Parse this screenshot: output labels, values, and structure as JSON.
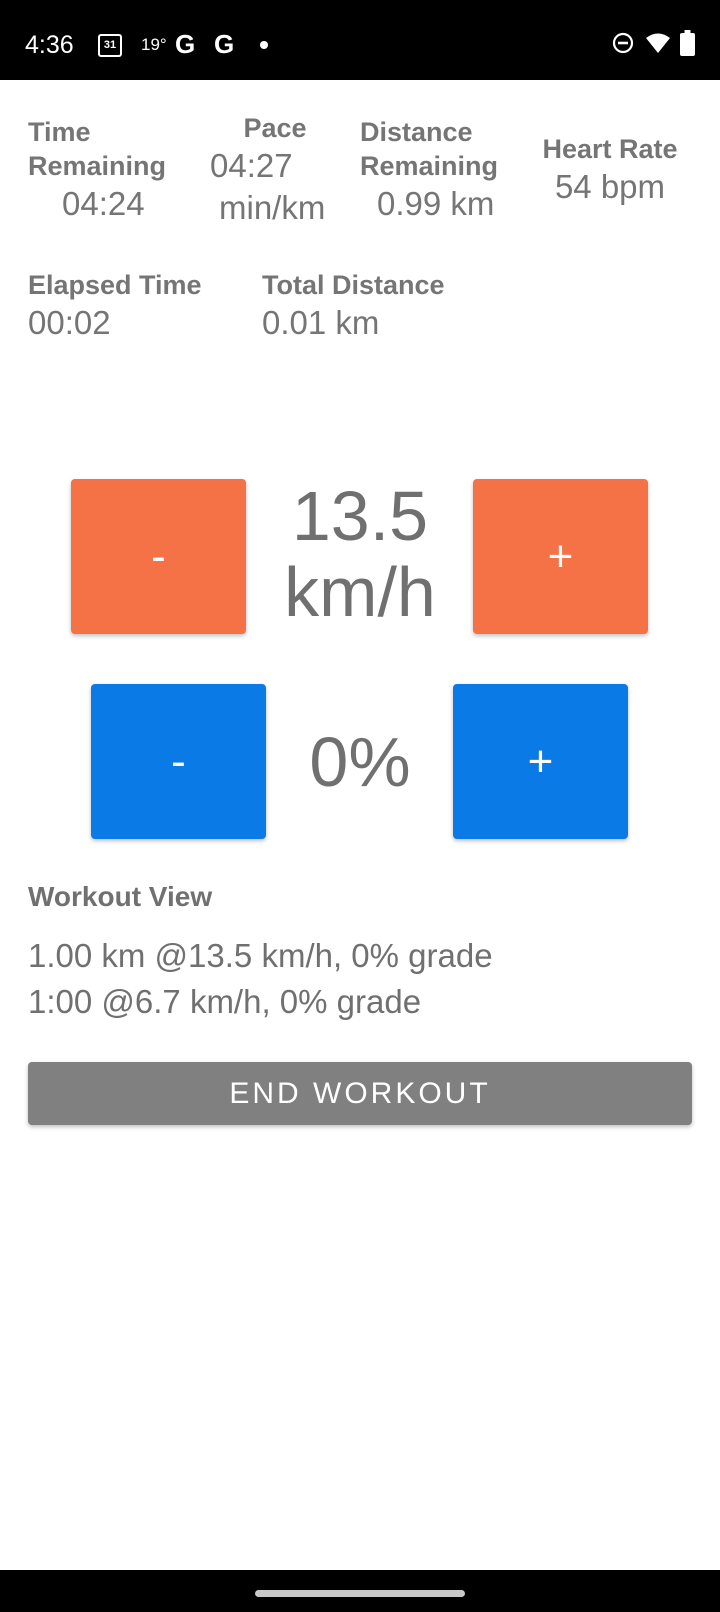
{
  "status_bar": {
    "time": "4:36",
    "calendar_day": "31",
    "temperature": "19°",
    "google_letter_1": "G",
    "google_letter_2": "G",
    "icons": [
      "calendar-icon",
      "google-icon",
      "google-icon",
      "notification-dot-icon",
      "do-not-disturb-icon",
      "wifi-icon",
      "battery-icon"
    ]
  },
  "stats": {
    "time_remaining": {
      "label_line1": "Time",
      "label_line2": "Remaining",
      "value": "04:24"
    },
    "pace": {
      "label": "Pace",
      "value_line1": "04:27",
      "value_line2": "min/km"
    },
    "distance_remaining": {
      "label_line1": "Distance",
      "label_line2": "Remaining",
      "value": "0.99 km"
    },
    "heart_rate": {
      "label": "Heart Rate",
      "value": "54 bpm"
    },
    "elapsed_time": {
      "label": "Elapsed Time",
      "value": "00:02"
    },
    "total_distance": {
      "label": "Total Distance",
      "value": "0.01 km"
    }
  },
  "speed": {
    "value": "13.5",
    "unit": "km/h",
    "decrease_label": "-",
    "increase_label": "+",
    "button_color": "#f47246"
  },
  "incline": {
    "value": "0%",
    "decrease_label": "-",
    "increase_label": "+",
    "button_color": "#0a7ae6"
  },
  "workout_view": {
    "title": "Workout View",
    "steps": [
      "1.00 km @13.5 km/h, 0% grade",
      "1:00 @6.7 km/h, 0% grade"
    ]
  },
  "end_button": {
    "label": "END WORKOUT",
    "color": "#808080"
  }
}
